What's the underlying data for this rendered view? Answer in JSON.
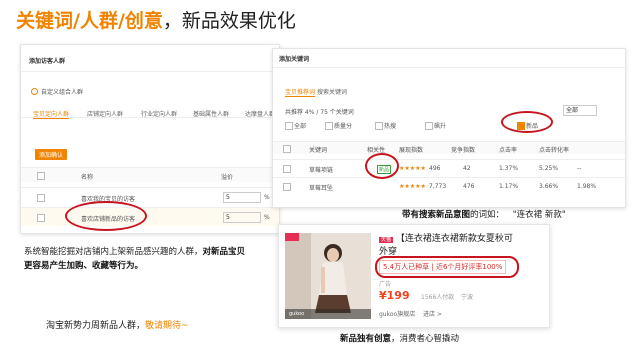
{
  "title": {
    "highlight": "关键词/人群/创意",
    "rest": "，新品效果优化"
  },
  "left_panel": {
    "header": "添加访客人群",
    "sub": "自定义组合人群",
    "tabs": [
      "宝贝定向人群",
      "店铺定向人群",
      "行业定向人群",
      "基础属性人群",
      "达摩盘人群"
    ],
    "button": "添加确认",
    "columns": [
      "名称",
      "溢价"
    ],
    "rows": [
      {
        "name": "喜欢我的宝贝的访客",
        "bid": "5"
      },
      {
        "name": "喜欢店铺新品的访客",
        "bid": "5"
      }
    ],
    "pct": [
      "%",
      "%"
    ],
    "extra": [
      "5%",
      "5%"
    ]
  },
  "right_panel": {
    "header": "添加关键词",
    "tabs": [
      "宝贝推荐词",
      "搜索关键词"
    ],
    "filter_label": "共推荐 4% / 75 个关键词",
    "filter_opts": [
      "全部",
      "质量分",
      "热搜",
      "飙升",
      "新品"
    ],
    "select": "全部",
    "columns": [
      "关键词",
      "相关性",
      "展现指数",
      "竞争指数",
      "点击率",
      "点击转化率"
    ],
    "rows": [
      {
        "kw": "草莓项链",
        "tag": "新品",
        "stars": "★★★★★",
        "imp": "496",
        "comp": "42",
        "ctr": "1.37%",
        "cvr": "5.25%",
        "extra": "--"
      },
      {
        "kw": "草莓耳坠",
        "tag": "",
        "stars": "★★★★★",
        "imp": "7,773",
        "comp": "476",
        "ctr": "1.17%",
        "cvr": "3.66%",
        "extra": "1.98%"
      }
    ]
  },
  "product": {
    "badge": "天猫",
    "title_line1": "【连衣裙连衣裙新款女夏秋可",
    "title_line2": "外穿",
    "stats": "5.4万人已种草 | 近6个月好评率100%",
    "sub": "广告",
    "price": "¥199",
    "sold": "1566人付款",
    "location": "宁波",
    "shop": "gukoo旗舰店",
    "enter_shop": "进店 >",
    "img_label": "gukoo"
  },
  "captions": {
    "right_top_bold": "带有搜索新品意图",
    "right_top_rest": "的词如：",
    "right_top_quote": "\"连衣裙 新款\"",
    "left_line1_a": "系统智能挖掘对店铺内上架新品感兴趣的人群，",
    "left_line1_b": "对新品宝贝",
    "left_line2": "更容易产生加购、收藏等行为。",
    "bottom_left_a": "淘宝新势力周新品人群，",
    "bottom_left_b": "敬请期待~",
    "bottom_right_bold": "新品独有创意",
    "bottom_right_rest": "，消费者心智撬动"
  }
}
